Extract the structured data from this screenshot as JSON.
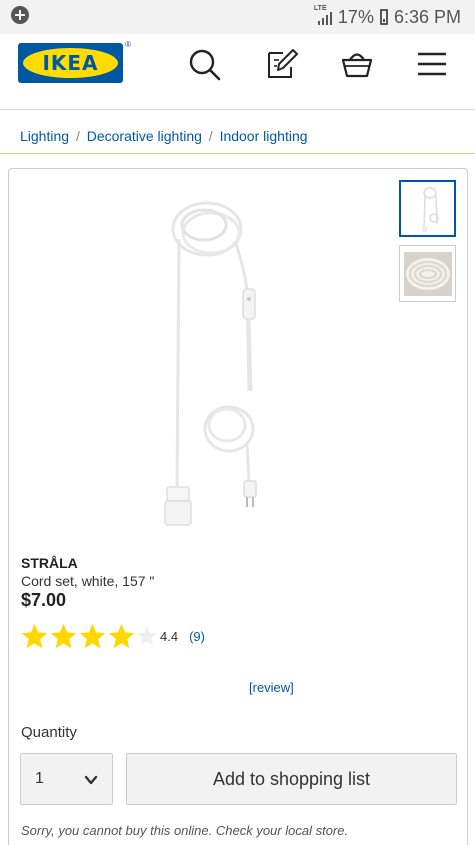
{
  "status_bar": {
    "network": "LTE",
    "battery": "17%",
    "time": "6:36 PM"
  },
  "header": {
    "logo_text": "IKEA",
    "logo_reg": "®",
    "icons": [
      "search-icon",
      "shopping-list-icon",
      "basket-icon",
      "menu-icon"
    ]
  },
  "breadcrumb": {
    "items": [
      "Lighting",
      "Decorative lighting",
      "Indoor lighting"
    ],
    "separator": "/"
  },
  "product": {
    "name": "STRÅLA",
    "description": "Cord set, white, 157 \"",
    "price": "$7.00",
    "rating": {
      "value": "4.4",
      "stars_filled": 4,
      "stars_total": 5,
      "count": "(9)"
    },
    "review_link": "[review]",
    "images": [
      "cord-set-main",
      "cord-set-coil-closeup"
    ],
    "selected_image": 0
  },
  "purchase": {
    "quantity_label": "Quantity",
    "quantity_value": "1",
    "add_button": "Add to shopping list",
    "notice": "Sorry, you cannot buy this online. Check your local store."
  },
  "colors": {
    "ikea_blue": "#0058a3",
    "ikea_yellow": "#ffdb00",
    "star_yellow": "#ffd700"
  }
}
